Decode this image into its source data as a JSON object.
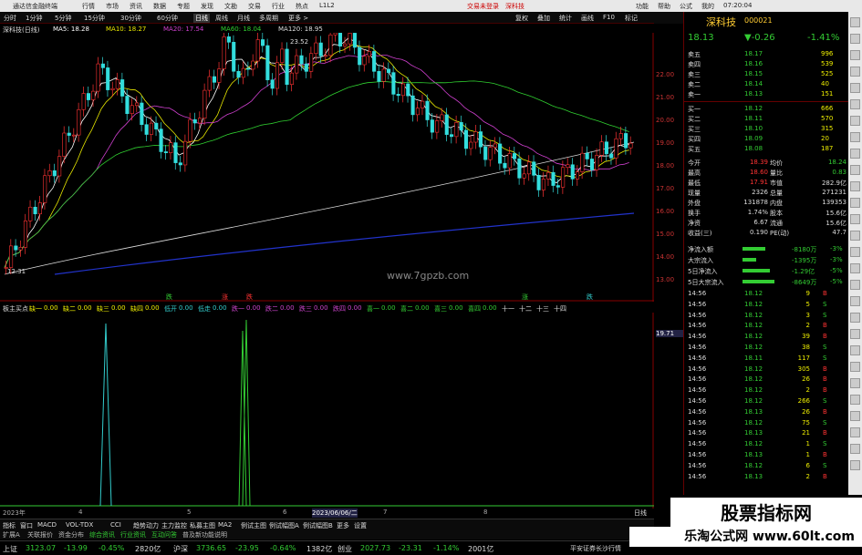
{
  "app": {
    "title": "通达信金融终端",
    "red_items": [
      "交易未登录",
      "深科技"
    ],
    "menu": [
      "行情",
      "市场",
      "资讯",
      "数据",
      "专题",
      "发现",
      "文勘",
      "交易",
      "行业",
      "热点",
      "L1L2"
    ],
    "window_right": [
      "功能",
      "帮助",
      "公式",
      "我的",
      "07:20:04"
    ]
  },
  "periods": [
    "分时",
    "1分钟",
    "5分钟",
    "15分钟",
    "30分钟",
    "60分钟",
    "日线",
    "周线",
    "月线",
    "多周期",
    "更多 >"
  ],
  "toolbar_right": [
    "复权",
    "叠加",
    "统计",
    "画线",
    "F10",
    "标记"
  ],
  "chart_header": {
    "name": "深科技(日线)",
    "ma": [
      {
        "label": "MA5: 18.28",
        "color": "#ffffff"
      },
      {
        "label": "MA10: 18.27",
        "color": "#e8e800"
      },
      {
        "label": "MA20: 17.54",
        "color": "#d040d0"
      },
      {
        "label": "MA60: 18.04",
        "color": "#30d030"
      },
      {
        "label": "MA120: 18.95",
        "color": "#dddddd"
      }
    ],
    "peak": "23.52",
    "low": "12.31"
  },
  "y_axis": [
    "22.00",
    "21.00",
    "20.00",
    "19.00",
    "18.00",
    "17.00",
    "16.00",
    "15.00",
    "14.00",
    "13.00"
  ],
  "sub_axis_top": "19.71",
  "indicator": {
    "name": "板主买点",
    "items": [
      {
        "l": "缺一",
        "v": "0.00"
      },
      {
        "l": "缺二",
        "v": "0.00"
      },
      {
        "l": "缺三",
        "v": "0.00"
      },
      {
        "l": "缺四",
        "v": "0.00"
      },
      {
        "l": "低开",
        "v": "0.00"
      },
      {
        "l": "低走",
        "v": "0.00"
      },
      {
        "l": "跌一",
        "v": "0.00"
      },
      {
        "l": "跌二",
        "v": "0.00"
      },
      {
        "l": "跌三",
        "v": "0.00"
      },
      {
        "l": "跌四",
        "v": "0.00"
      },
      {
        "l": "喜一",
        "v": "0.00"
      },
      {
        "l": "喜二",
        "v": "0.00"
      },
      {
        "l": "喜三",
        "v": "0.00"
      },
      {
        "l": "喜四",
        "v": "0.00"
      },
      {
        "l": "十一",
        "v": ""
      },
      {
        "l": "十二",
        "v": ""
      },
      {
        "l": "十三",
        "v": ""
      },
      {
        "l": "十四",
        "v": ""
      }
    ]
  },
  "markers": [
    "跌",
    "涨",
    "跌",
    "涨",
    "跌"
  ],
  "time_axis": {
    "labels": [
      "2023年",
      "4",
      "5",
      "6",
      "2023/06/06/二",
      "7",
      "8"
    ],
    "cursor": "日线"
  },
  "tabs": [
    "指标",
    "窗口",
    "MACD",
    "VOL-TDX",
    "CCI",
    "趋势动力",
    "主力监控",
    "私募主图",
    "MA2",
    "例试主图",
    "例试幅图A",
    "例试幅图B",
    "更多",
    "设置"
  ],
  "tabs2": [
    "扩展A",
    "关联报价",
    "资金分布",
    "综合资讯",
    "行业资讯",
    "互动问答",
    "普及新功能说明"
  ],
  "status": {
    "sh_label": "上证",
    "sh": "3123.07",
    "sh_chg": "-13.99",
    "sh_pct": "-0.45%",
    "sh_amt": "2820亿",
    "hs_label": "沪深",
    "hs": "3736.65",
    "hs_chg": "-23.95",
    "hs_pct": "-0.64%",
    "hs_amt": "1382亿",
    "cy_label": "创业",
    "cy": "2027.73",
    "cy_chg": "-23.31",
    "cy_pct": "-1.14%",
    "cy_amt": "2001亿",
    "broker": "平安证券长沙行情"
  },
  "quote": {
    "name": "深科技",
    "code": "000021",
    "price": "18.13",
    "change": "▼-0.26",
    "pct": "-1.41%",
    "asks": [
      {
        "l": "卖五",
        "p": "18.17",
        "v": "996"
      },
      {
        "l": "卖四",
        "p": "18.16",
        "v": "539"
      },
      {
        "l": "卖三",
        "p": "18.15",
        "v": "525"
      },
      {
        "l": "卖二",
        "p": "18.14",
        "v": "40"
      },
      {
        "l": "卖一",
        "p": "18.13",
        "v": "151"
      }
    ],
    "bids": [
      {
        "l": "买一",
        "p": "18.12",
        "v": "666"
      },
      {
        "l": "买二",
        "p": "18.11",
        "v": "570"
      },
      {
        "l": "买三",
        "p": "18.10",
        "v": "315"
      },
      {
        "l": "买四",
        "p": "18.09",
        "v": "20"
      },
      {
        "l": "买五",
        "p": "18.08",
        "v": "187"
      }
    ],
    "stats": [
      {
        "l": "今开",
        "v": "18.39",
        "l2": "均价",
        "v2": "18.24"
      },
      {
        "l": "最高",
        "v": "18.60",
        "l2": "量比",
        "v2": "0.83"
      },
      {
        "l": "最低",
        "v": "17.91",
        "l2": "市值",
        "v2": "282.9亿"
      },
      {
        "l": "现量",
        "v": "2326",
        "l2": "总量",
        "v2": "271231"
      },
      {
        "l": "外盘",
        "v": "131878",
        "l2": "内盘",
        "v2": "139353"
      },
      {
        "l": "换手",
        "v": "1.74%",
        "l2": "股本",
        "v2": "15.6亿"
      },
      {
        "l": "净资",
        "v": "6.67",
        "l2": "流通",
        "v2": "15.6亿"
      },
      {
        "l": "收益(三)",
        "v": "0.190",
        "l2": "PE(动)",
        "v2": "47.7"
      }
    ],
    "flows": [
      {
        "l": "净流入额",
        "v": "-8180万",
        "p": "-3%",
        "fill": 0.5
      },
      {
        "l": "大宗流入",
        "v": "-1395万",
        "p": "-3%",
        "fill": 0.3
      },
      {
        "l": "5日净流入",
        "v": "-1.29亿",
        "p": "-5%",
        "fill": 0.6
      },
      {
        "l": "5日大宗流入",
        "v": "-8649万",
        "p": "-5%",
        "fill": 0.7
      }
    ],
    "ticks": [
      {
        "t": "14:56",
        "p": "18.12",
        "v": "9",
        "d": "B"
      },
      {
        "t": "14:56",
        "p": "18.12",
        "v": "5",
        "d": "S"
      },
      {
        "t": "14:56",
        "p": "18.12",
        "v": "3",
        "d": "S"
      },
      {
        "t": "14:56",
        "p": "18.12",
        "v": "2",
        "d": "B"
      },
      {
        "t": "14:56",
        "p": "18.12",
        "v": "39",
        "d": "B"
      },
      {
        "t": "14:56",
        "p": "18.12",
        "v": "38",
        "d": "S"
      },
      {
        "t": "14:56",
        "p": "18.11",
        "v": "117",
        "d": "S"
      },
      {
        "t": "14:56",
        "p": "18.12",
        "v": "305",
        "d": "B"
      },
      {
        "t": "14:56",
        "p": "18.12",
        "v": "26",
        "d": "B"
      },
      {
        "t": "14:56",
        "p": "18.12",
        "v": "2",
        "d": "B"
      },
      {
        "t": "14:56",
        "p": "18.12",
        "v": "266",
        "d": "S"
      },
      {
        "t": "14:56",
        "p": "18.13",
        "v": "26",
        "d": "B"
      },
      {
        "t": "14:56",
        "p": "18.12",
        "v": "75",
        "d": "S"
      },
      {
        "t": "14:56",
        "p": "18.13",
        "v": "21",
        "d": "B"
      },
      {
        "t": "14:56",
        "p": "18.12",
        "v": "1",
        "d": "S"
      },
      {
        "t": "14:56",
        "p": "18.13",
        "v": "1",
        "d": "B"
      },
      {
        "t": "14:56",
        "p": "18.12",
        "v": "6",
        "d": "S"
      },
      {
        "t": "14:56",
        "p": "18.13",
        "v": "2",
        "d": "B"
      }
    ]
  },
  "watermark": "www.7gpzb.com",
  "brand1": "股票指标网",
  "brand2": "乐淘公式网 www.60lt.com"
}
